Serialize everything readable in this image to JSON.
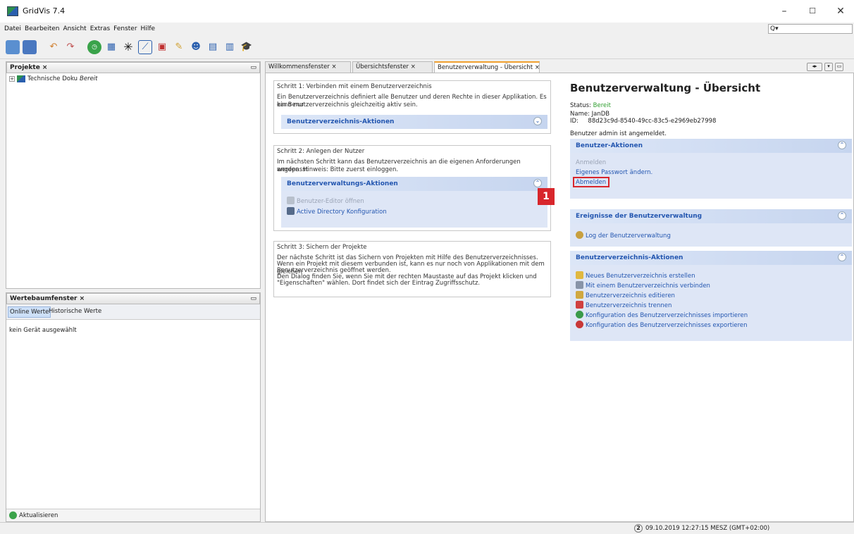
{
  "window": {
    "title": "GridVis 7.4"
  },
  "menu": [
    "Datei",
    "Bearbeiten",
    "Ansicht",
    "Extras",
    "Fenster",
    "Hilfe"
  ],
  "search": {
    "placeholder": "Q▾"
  },
  "projects_panel": {
    "title": "Projekte ×",
    "tree_item_name": "Technische Doku",
    "tree_item_status": "Bereit"
  },
  "values_panel": {
    "title": "Wertebaumfenster ×",
    "tabs": [
      "Online Werte",
      "Historische Werte"
    ],
    "empty_text": "kein Gerät ausgewählt",
    "refresh_label": "Aktualisieren"
  },
  "tabs": [
    {
      "label": "Willkommensfenster ×"
    },
    {
      "label": "Übersichtsfenster ×"
    },
    {
      "label": "Benutzerverwaltung - Übersicht ×"
    }
  ],
  "step1": {
    "title": "Schritt 1: Verbinden mit einem Benutzerverzeichnis",
    "text1": "Ein Benutzerverzeichnis definiert alle Benutzer und deren Rechte in dieser Applikation. Es kann nur",
    "text2": "ein Benutzerverzeichnis gleichzeitig aktiv sein.",
    "section": "Benutzerverzeichnis-Aktionen"
  },
  "step2": {
    "title": "Schritt 2: Anlegen der Nutzer",
    "text1": "Im nächsten Schritt kann das Benutzerverzeichnis an die eigenen Anforderungen angepasst",
    "text2": "werden. Hinweis: Bitte zuerst einloggen.",
    "section": "Benutzerverwaltungs-Aktionen",
    "actions": [
      "Benutzer-Editor öffnen",
      "Active Directory Konfiguration"
    ]
  },
  "step3": {
    "title": "Schritt 3: Sichern der Projekte",
    "lines": [
      "Der nächste Schritt ist das Sichern von Projekten mit Hilfe des Benutzerverzeichnisses.",
      "Wenn ein Projekt mit diesem verbunden ist, kann es nur noch von Applikationen mit dem gleichen",
      "Benutzerverzeichnis geöffnet werden.",
      "Den Dialog finden Sie, wenn Sie mit der rechten Maustaste auf das Projekt klicken und",
      "\"Eigenschaften\" wählen. Dort findet sich der Eintrag Zugriffsschutz."
    ]
  },
  "overview": {
    "heading": "Benutzerverwaltung - Übersicht",
    "status_label": "Status:",
    "status_value": "Bereit",
    "name_line": "Name: JanDB",
    "id_line": "ID:     88d23c9d-8540-49cc-83c5-e2969eb27998",
    "logged_in": "Benutzer admin ist angemeldet.",
    "user_actions_title": "Benutzer-Aktionen",
    "user_actions": [
      "Anmelden",
      "Eigenes Passwort ändern.",
      "Abmelden"
    ],
    "events_title": "Ereignisse der Benutzerverwaltung",
    "events_log": "Log der Benutzerverwaltung",
    "dir_actions_title": "Benutzerverzeichnis-Aktionen",
    "dir_actions": [
      "Neues Benutzerverzeichnis erstellen",
      "Mit einem Benutzerverzeichnis verbinden",
      "Benutzerverzeichnis editieren",
      "Benutzerverzeichnis trennen",
      "Konfiguration des Benutzerverzeichnisses importieren",
      "Konfiguration des Benutzerverzeichnisses exportieren"
    ]
  },
  "callout": {
    "number": "1"
  },
  "statusbar": {
    "badge": "2",
    "datetime": "09.10.2019 12:27:15 MESZ (GMT+02:00)"
  },
  "colors": {
    "link": "#2356b0",
    "callout": "#d8262c",
    "status_ok": "#2e9e2e",
    "tab_accent": "#f0a030"
  }
}
